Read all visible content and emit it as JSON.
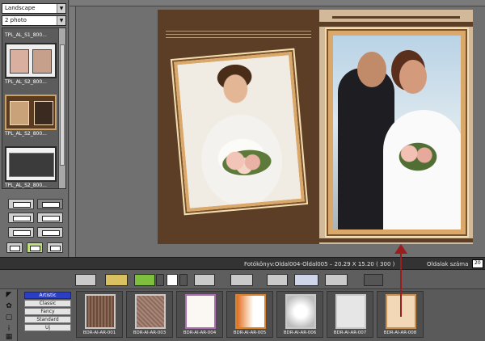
{
  "left_panel": {
    "orientation_select": "Landscape",
    "photo_count_select": "2 photo",
    "templates": [
      {
        "label": "TPL_AL_S1_800..."
      },
      {
        "label": "TPL_AL_S2_800..."
      },
      {
        "label": "TPL_AL_S2_800..."
      },
      {
        "label": "TPL_AL_S2_800..."
      }
    ]
  },
  "info_bar": {
    "album_info": "Fotókönyv:Oldal004-Oldal005  –  20.29 X 15.20 ( 300 )",
    "page_count_label": "Oldalak száma",
    "page_count_value": "20"
  },
  "styles": [
    "Artistic",
    "Classic",
    "Fancy",
    "Standard",
    "Uj"
  ],
  "borders": [
    {
      "label": "BDR-AI-AR-001"
    },
    {
      "label": "BDR-AI-AR-003"
    },
    {
      "label": "BDR-AI-AR-004"
    },
    {
      "label": "BDR-AI-AR-005"
    },
    {
      "label": "BDR-AI-AR-006"
    },
    {
      "label": "BDR-AI-AR-007"
    },
    {
      "label": "BDR-AI-AR-008"
    }
  ],
  "colors": {
    "page_left": "#5c3e26",
    "page_right": "#d2b99a",
    "frame_gold": "#d9a86a",
    "arrow": "#9b1c1c",
    "active_style": "#2c3ec3"
  }
}
